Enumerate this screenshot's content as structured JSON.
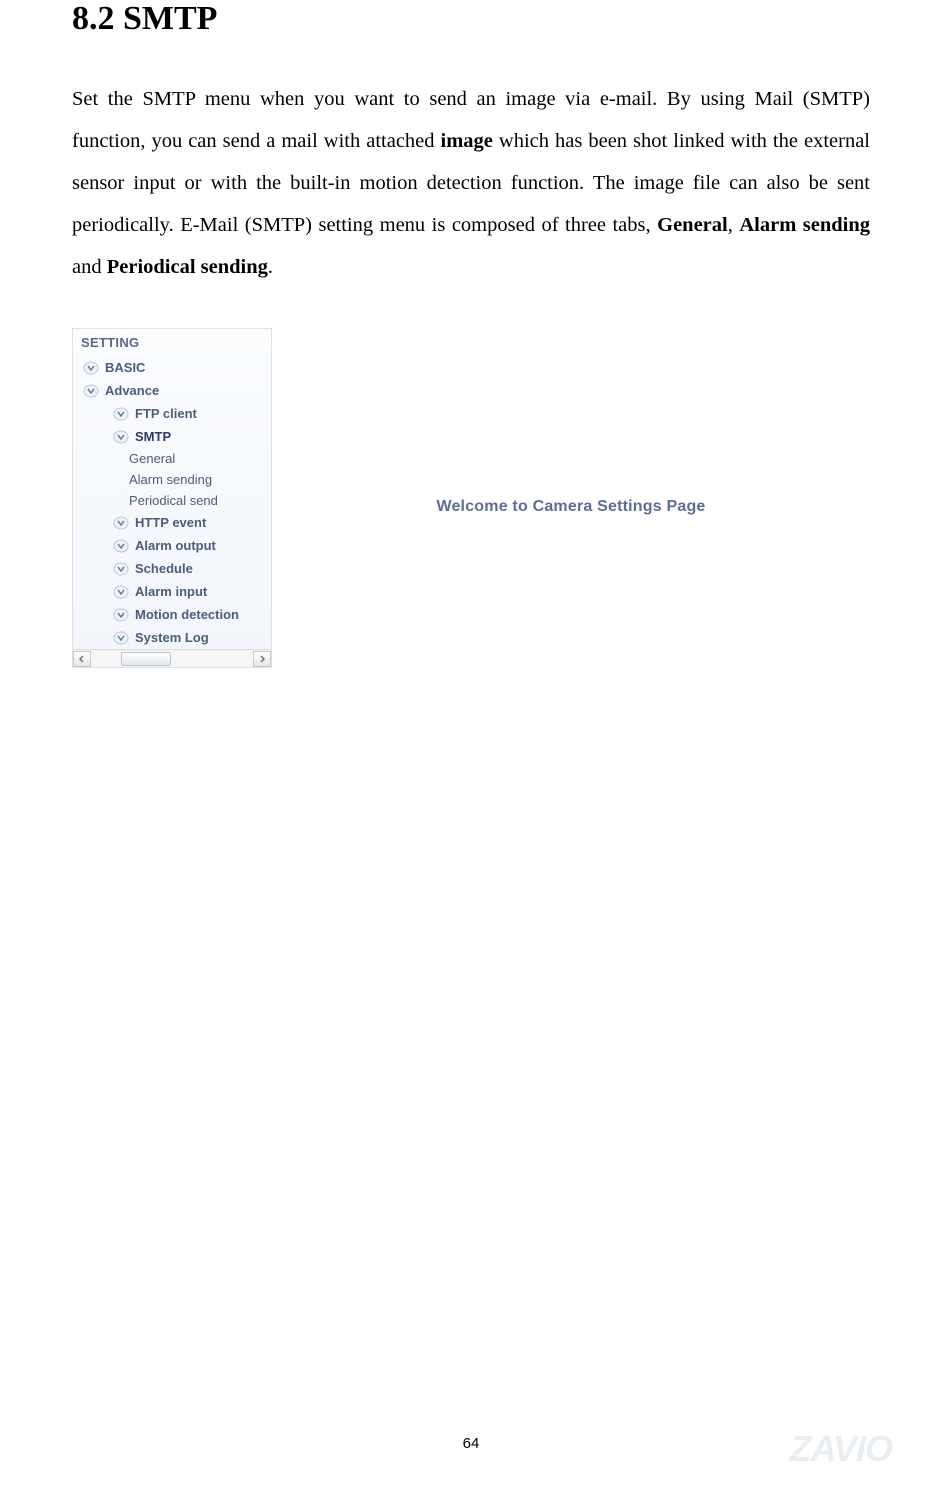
{
  "section_title": "8.2 SMTP",
  "paragraph": {
    "p1": "Set the SMTP menu when you want to send an image via e-mail. By using Mail (SMTP) function, you can send a mail with attached ",
    "bold1": "image",
    "p2": " which has been shot linked with the external sensor input or with the built-in motion detection function. The image file can also be sent periodically. E-Mail (SMTP) setting menu is composed of three tabs, ",
    "bold2": "General",
    "p3": ", ",
    "bold3": "Alarm sending",
    "p4": " and ",
    "bold4": "Periodical sending",
    "p5": "."
  },
  "sidebar": {
    "header": "SETTING",
    "basic": "BASIC",
    "advance": "Advance",
    "ftp": "FTP client",
    "smtp": "SMTP",
    "smtp_general": "General",
    "smtp_alarm": "Alarm sending",
    "smtp_periodical": "Periodical send",
    "http_event": "HTTP event",
    "alarm_output": "Alarm output",
    "schedule": "Schedule",
    "alarm_input": "Alarm input",
    "motion_detection": "Motion detection",
    "system_log": "System Log"
  },
  "content": {
    "welcome": "Welcome to Camera Settings Page"
  },
  "page_number": "64",
  "watermark": "ZAVIO"
}
